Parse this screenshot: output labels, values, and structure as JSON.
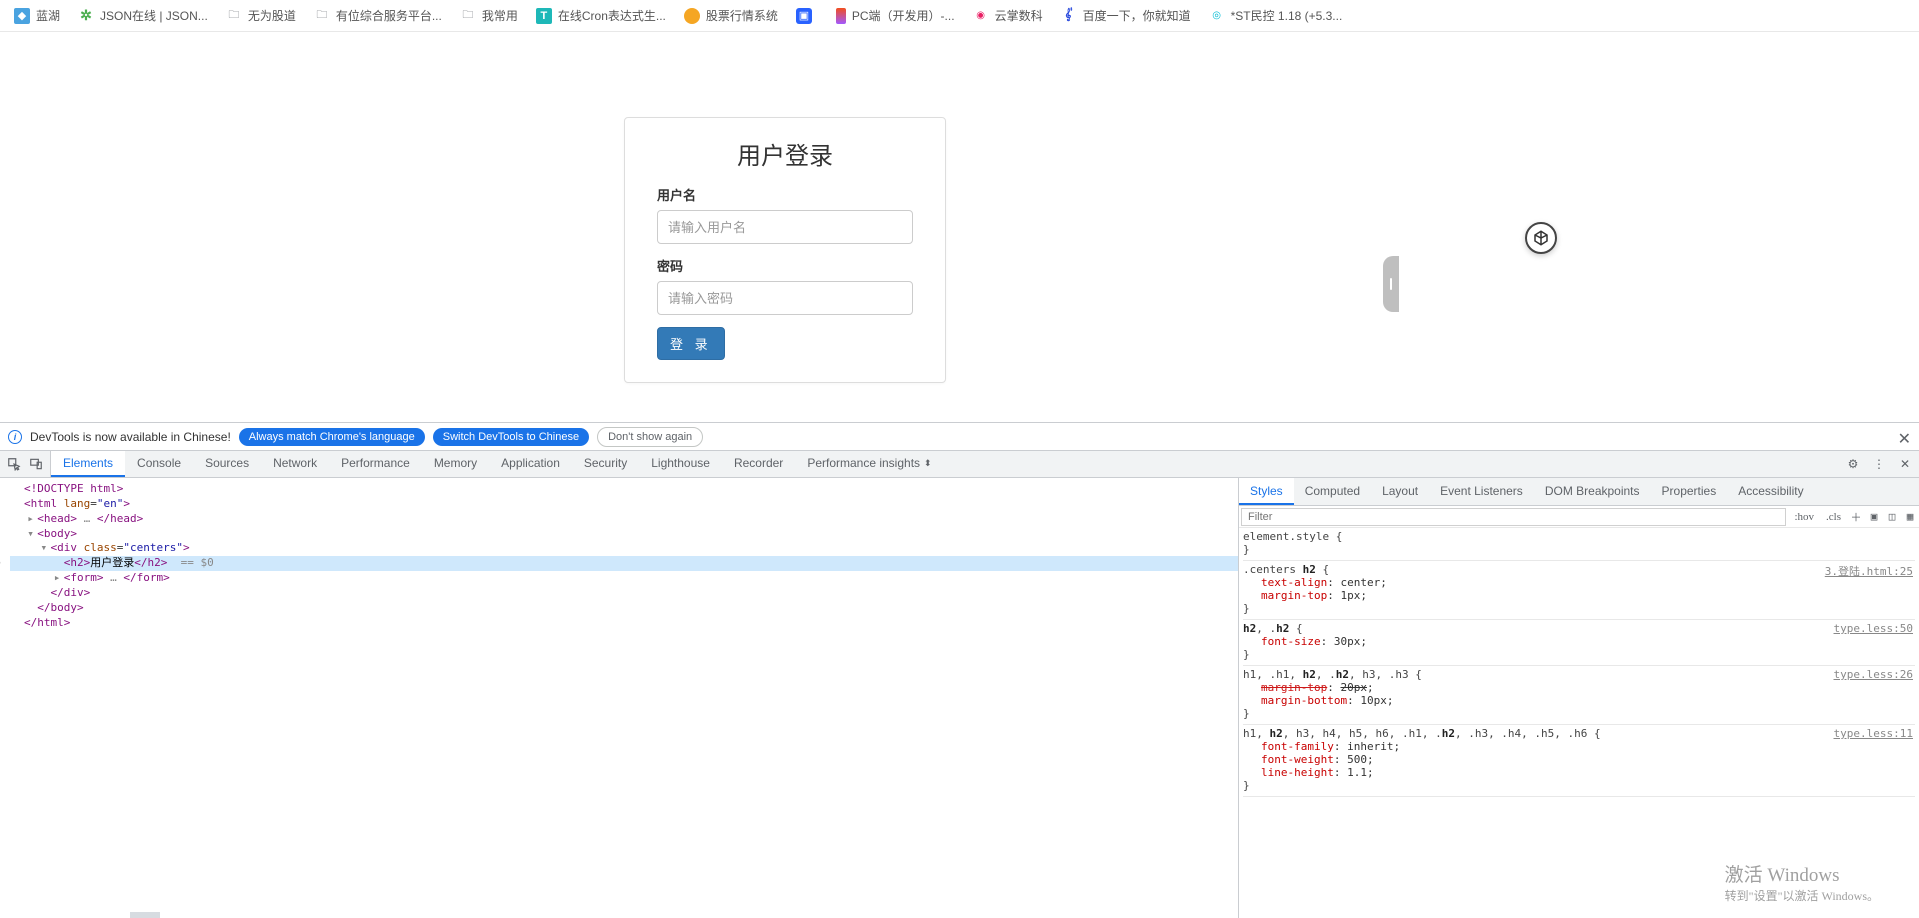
{
  "bookmarks": [
    {
      "label": "蓝湖",
      "icon": "bk-blue"
    },
    {
      "label": "JSON在线 | JSON...",
      "icon": "bk-green"
    },
    {
      "label": "无为股道",
      "icon": "bk-folder"
    },
    {
      "label": "有位综合服务平台...",
      "icon": "bk-folder"
    },
    {
      "label": "我常用",
      "icon": "bk-folder"
    },
    {
      "label": "在线Cron表达式生...",
      "icon": "bk-teal"
    },
    {
      "label": "股票行情系统",
      "icon": "bk-orange"
    },
    {
      "label": "",
      "icon": "bk-bluebox"
    },
    {
      "label": "PC端（开发用）-...",
      "icon": "bk-figma"
    },
    {
      "label": "云掌数科",
      "icon": "bk-red"
    },
    {
      "label": "百度一下，你就知道",
      "icon": "bk-baidu"
    },
    {
      "label": "*ST民控 1.18 (+5.3...",
      "icon": "bk-cyan"
    }
  ],
  "login": {
    "title": "用户登录",
    "username_label": "用户名",
    "username_placeholder": "请输入用户名",
    "password_label": "密码",
    "password_placeholder": "请输入密码",
    "submit": "登 录"
  },
  "devtools_info": {
    "msg": "DevTools is now available in Chinese!",
    "btn1": "Always match Chrome's language",
    "btn2": "Switch DevTools to Chinese",
    "btn3": "Don't show again"
  },
  "main_tabs": [
    "Elements",
    "Console",
    "Sources",
    "Network",
    "Performance",
    "Memory",
    "Application",
    "Security",
    "Lighthouse",
    "Recorder",
    "Performance insights"
  ],
  "main_tabs_active": "Elements",
  "dom_lines": [
    {
      "indent": 0,
      "arrow": "",
      "html": "<span class='tag'>&lt;!DOCTYPE html&gt;</span>"
    },
    {
      "indent": 0,
      "arrow": "",
      "html": "<span class='tag'>&lt;html</span> <span class='attr'>lang</span>=<span class='val'>\"en\"</span><span class='tag'>&gt;</span>"
    },
    {
      "indent": 1,
      "arrow": "▸",
      "html": "<span class='tag'>&lt;head&gt;</span> <span class='eq0'>…</span> <span class='tag'>&lt;/head&gt;</span>"
    },
    {
      "indent": 1,
      "arrow": "▾",
      "html": "<span class='tag'>&lt;body&gt;</span>"
    },
    {
      "indent": 2,
      "arrow": "▾",
      "html": "<span class='tag'>&lt;div</span> <span class='attr'>class</span>=<span class='val'>\"centers\"</span><span class='tag'>&gt;</span>"
    },
    {
      "indent": 3,
      "arrow": "",
      "sel": true,
      "dots": true,
      "html": "<span class='tag'>&lt;h2&gt;</span><span class='text'>用户登录</span><span class='tag'>&lt;/h2&gt;</span>  <span class='eq0'>== $0</span>"
    },
    {
      "indent": 3,
      "arrow": "▸",
      "html": "<span class='tag'>&lt;form&gt;</span> <span class='eq0'>…</span> <span class='tag'>&lt;/form&gt;</span>"
    },
    {
      "indent": 2,
      "arrow": "",
      "html": "<span class='tag'>&lt;/div&gt;</span>"
    },
    {
      "indent": 1,
      "arrow": "",
      "html": "<span class='tag'>&lt;/body&gt;</span>"
    },
    {
      "indent": 0,
      "arrow": "",
      "html": "<span class='tag'>&lt;/html&gt;</span>"
    }
  ],
  "styles_tabs": [
    "Styles",
    "Computed",
    "Layout",
    "Event Listeners",
    "DOM Breakpoints",
    "Properties",
    "Accessibility"
  ],
  "styles_tabs_active": "Styles",
  "styles_filter_placeholder": "Filter",
  "styles_chips": {
    "hov": ":hov",
    "cls": ".cls"
  },
  "rules": [
    {
      "selector": "element.style",
      "src": "",
      "props": []
    },
    {
      "selector": ".centers h2",
      "src": "3.登陆.html:25",
      "props": [
        {
          "k": "text-align",
          "v": "center"
        },
        {
          "k": "margin-top",
          "v": "1px"
        }
      ]
    },
    {
      "selector": "h2, .h2",
      "src": "type.less:50",
      "props": [
        {
          "k": "font-size",
          "v": "30px"
        }
      ]
    },
    {
      "selector": "h1, .h1, h2, .h2, h3, .h3",
      "src": "type.less:26",
      "props": [
        {
          "k": "margin-top",
          "v": "20px",
          "struck": true
        },
        {
          "k": "margin-bottom",
          "v": "10px"
        }
      ]
    },
    {
      "selector": "h1, h2, h3, h4, h5, h6, .h1, .h2, .h3, .h4, .h5, .h6",
      "src": "type.less:11",
      "props": [
        {
          "k": "font-family",
          "v": "inherit"
        },
        {
          "k": "font-weight",
          "v": "500"
        },
        {
          "k": "line-height",
          "v": "1.1"
        }
      ]
    }
  ],
  "watermark": {
    "l1": "激活 Windows",
    "l2": "转到\"设置\"以激活 Windows。"
  }
}
